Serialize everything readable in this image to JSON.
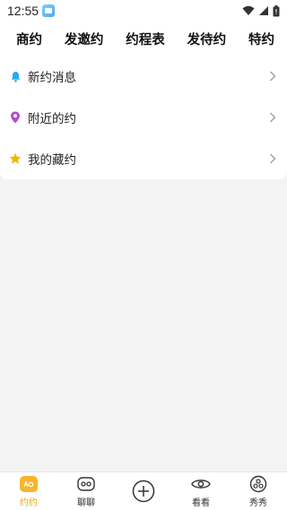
{
  "status_bar": {
    "time": "12:55",
    "icons": [
      "app-notification-icon",
      "wifi-icon",
      "signal-icon",
      "battery-icon"
    ]
  },
  "top_tabs": [
    {
      "label": "商约"
    },
    {
      "label": "发邀约"
    },
    {
      "label": "约程表"
    },
    {
      "label": "发待约"
    },
    {
      "label": "特约"
    }
  ],
  "menu": {
    "items": [
      {
        "label": "新约消息",
        "icon": "bell-icon",
        "icon_color": "#2aa8ee"
      },
      {
        "label": "附近的约",
        "icon": "location-pin-icon",
        "icon_color": "#b04ad6"
      },
      {
        "label": "我的藏约",
        "icon": "star-icon",
        "icon_color": "#f5b400"
      }
    ]
  },
  "bottom_nav": {
    "items": [
      {
        "label": "约约",
        "icon": "yueyue-icon",
        "active": true
      },
      {
        "label": "聊聊",
        "icon": "chat-icon",
        "active": false
      },
      {
        "label": "",
        "icon": "add-circle-icon",
        "active": false
      },
      {
        "label": "看看",
        "icon": "eye-icon",
        "active": false
      },
      {
        "label": "秀秀",
        "icon": "show-icon",
        "active": false
      }
    ],
    "active_color": "#f0a500"
  }
}
